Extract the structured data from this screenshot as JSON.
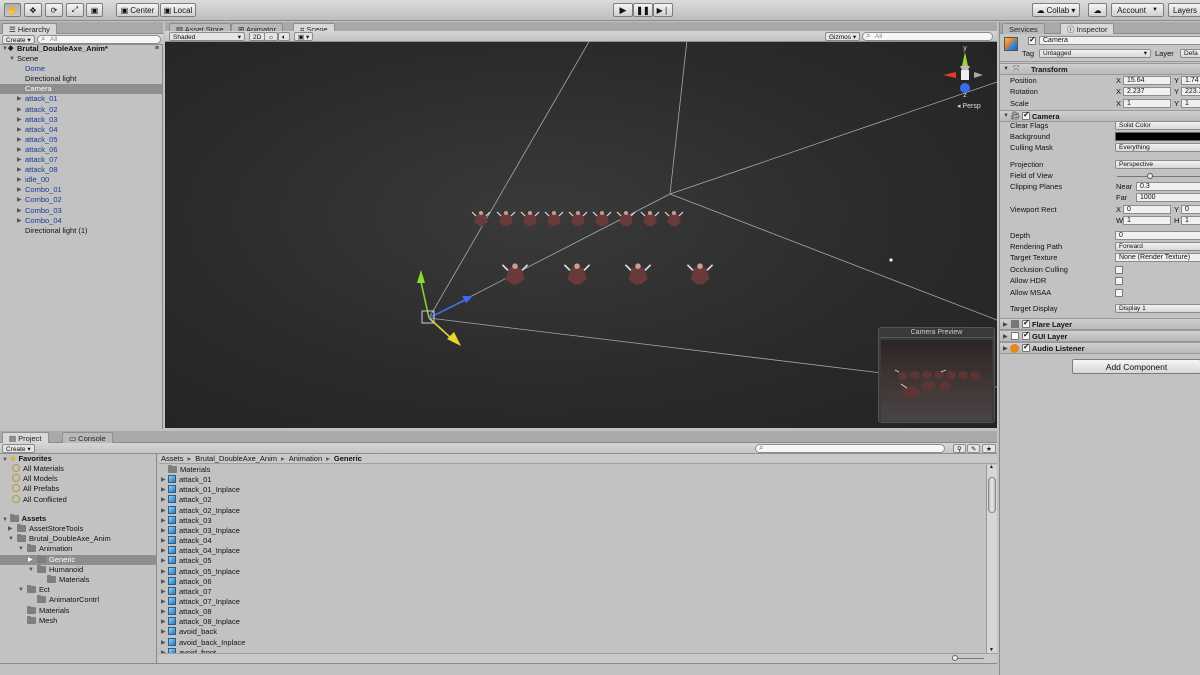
{
  "toolbar": {
    "pivot": "Center",
    "space": "Local",
    "collab": "Collab ▾",
    "account": "Account",
    "layers": "Layers"
  },
  "hierarchy": {
    "tab": "Hierarchy",
    "create": "Create",
    "search_placeholder": "All",
    "scene_name": "Brutal_DoubleAxe_Anim*",
    "items": [
      {
        "label": "Scene",
        "indent": 1,
        "tri": true,
        "open": true,
        "blue": false,
        "sel": false
      },
      {
        "label": "Dome",
        "indent": 2,
        "tri": false,
        "blue": true,
        "sel": false
      },
      {
        "label": "Directional light",
        "indent": 2,
        "tri": false,
        "blue": false,
        "sel": false
      },
      {
        "label": "Camera",
        "indent": 2,
        "tri": false,
        "blue": false,
        "sel": true
      },
      {
        "label": "attack_01",
        "indent": 2,
        "tri": true,
        "blue": true,
        "sel": false
      },
      {
        "label": "attack_02",
        "indent": 2,
        "tri": true,
        "blue": true,
        "sel": false
      },
      {
        "label": "attack_03",
        "indent": 2,
        "tri": true,
        "blue": true,
        "sel": false
      },
      {
        "label": "attack_04",
        "indent": 2,
        "tri": true,
        "blue": true,
        "sel": false
      },
      {
        "label": "attack_05",
        "indent": 2,
        "tri": true,
        "blue": true,
        "sel": false
      },
      {
        "label": "attack_06",
        "indent": 2,
        "tri": true,
        "blue": true,
        "sel": false
      },
      {
        "label": "attack_07",
        "indent": 2,
        "tri": true,
        "blue": true,
        "sel": false
      },
      {
        "label": "attack_08",
        "indent": 2,
        "tri": true,
        "blue": true,
        "sel": false
      },
      {
        "label": "idle_00",
        "indent": 2,
        "tri": true,
        "blue": true,
        "sel": false
      },
      {
        "label": "Combo_01",
        "indent": 2,
        "tri": true,
        "blue": true,
        "sel": false
      },
      {
        "label": "Combo_02",
        "indent": 2,
        "tri": true,
        "blue": true,
        "sel": false
      },
      {
        "label": "Combo_03",
        "indent": 2,
        "tri": true,
        "blue": true,
        "sel": false
      },
      {
        "label": "Combo_04",
        "indent": 2,
        "tri": true,
        "blue": true,
        "sel": false
      },
      {
        "label": "Directional light (1)",
        "indent": 2,
        "tri": false,
        "blue": false,
        "sel": false
      }
    ]
  },
  "scene_tabs": [
    "Asset Store",
    "Animator",
    "Scene"
  ],
  "scene_bar": {
    "shading": "Shaded",
    "mode_2d": "2D",
    "gizmos": "Gizmos",
    "search_placeholder": "All",
    "persp": "Persp",
    "axis_y": "y",
    "axis_z": "z",
    "camera_preview": "Camera Preview"
  },
  "project": {
    "tabs": [
      "Project",
      "Console"
    ],
    "create": "Create",
    "favorites_title": "Favorites",
    "favorites": [
      "All Materials",
      "All Models",
      "All Prefabs",
      "All Conflicted"
    ],
    "assets_title": "Assets",
    "tree": [
      {
        "label": "AssetStoreTools",
        "indent": 1,
        "tri": "closed",
        "sel": false
      },
      {
        "label": "Brutal_DoubleAxe_Anim",
        "indent": 1,
        "tri": "open",
        "sel": false
      },
      {
        "label": "Animation",
        "indent": 2,
        "tri": "open",
        "sel": false
      },
      {
        "label": "Generic",
        "indent": 3,
        "tri": "closed",
        "sel": true
      },
      {
        "label": "Humanoid",
        "indent": 3,
        "tri": "open",
        "sel": false
      },
      {
        "label": "Materials",
        "indent": 4,
        "tri": "none",
        "sel": false
      },
      {
        "label": "Ect",
        "indent": 2,
        "tri": "open",
        "sel": false
      },
      {
        "label": "AnimatorContrl",
        "indent": 3,
        "tri": "none",
        "sel": false
      },
      {
        "label": "Materials",
        "indent": 2,
        "tri": "none",
        "sel": false
      },
      {
        "label": "Mesh",
        "indent": 2,
        "tri": "none",
        "sel": false
      }
    ],
    "breadcrumb": [
      "Assets",
      "Brutal_DoubleAxe_Anim",
      "Animation",
      "Generic"
    ],
    "files": [
      {
        "label": "Materials",
        "type": "folder"
      },
      {
        "label": "attack_01",
        "type": "asset"
      },
      {
        "label": "attack_01_Inplace",
        "type": "asset"
      },
      {
        "label": "attack_02",
        "type": "asset"
      },
      {
        "label": "attack_02_Inplace",
        "type": "asset"
      },
      {
        "label": "attack_03",
        "type": "asset"
      },
      {
        "label": "attack_03_Inplace",
        "type": "asset"
      },
      {
        "label": "attack_04",
        "type": "asset"
      },
      {
        "label": "attack_04_Inplace",
        "type": "asset"
      },
      {
        "label": "attack_05",
        "type": "asset"
      },
      {
        "label": "attack_05_Inplace",
        "type": "asset"
      },
      {
        "label": "attack_06",
        "type": "asset"
      },
      {
        "label": "attack_07",
        "type": "asset"
      },
      {
        "label": "attack_07_Inplace",
        "type": "asset"
      },
      {
        "label": "attack_08",
        "type": "asset"
      },
      {
        "label": "attack_08_Inplace",
        "type": "asset"
      },
      {
        "label": "avoid_back",
        "type": "asset"
      },
      {
        "label": "avoid_back_Inplace",
        "type": "asset"
      },
      {
        "label": "avoid_front",
        "type": "asset"
      }
    ]
  },
  "inspector": {
    "tabs": [
      "Services",
      "Inspector"
    ],
    "object_name": "Camera",
    "tag_label": "Tag",
    "tag_value": "Untagged",
    "layer_label": "Layer",
    "layer_value": "Defa",
    "transform": {
      "title": "Transform",
      "rows": [
        {
          "label": "Position",
          "x": "15.64",
          "y": "1.74"
        },
        {
          "label": "Rotation",
          "x": "2.237",
          "y": "223.3"
        },
        {
          "label": "Scale",
          "x": "1",
          "y": "1"
        }
      ]
    },
    "camera": {
      "title": "Camera",
      "clear_flags": {
        "label": "Clear Flags",
        "value": "Solid Color"
      },
      "background": {
        "label": "Background",
        "color": "#000000"
      },
      "culling_mask": {
        "label": "Culling Mask",
        "value": "Everything"
      },
      "projection": {
        "label": "Projection",
        "value": "Perspective"
      },
      "fov": {
        "label": "Field of View"
      },
      "clipping": {
        "label": "Clipping Planes",
        "near_label": "Near",
        "near": "0.3",
        "far_label": "Far",
        "far": "1000"
      },
      "viewport": {
        "label": "Viewport Rect",
        "x": "0",
        "y": "0",
        "w": "1",
        "h": "1"
      },
      "depth": {
        "label": "Depth",
        "value": "0"
      },
      "rendering_path": {
        "label": "Rendering Path",
        "value": "Forward"
      },
      "target_texture": {
        "label": "Target Texture",
        "value": "None (Render Texture)"
      },
      "occlusion": {
        "label": "Occlusion Culling"
      },
      "hdr": {
        "label": "Allow HDR"
      },
      "msaa": {
        "label": "Allow MSAA"
      },
      "target_display": {
        "label": "Target Display",
        "value": "Display 1"
      }
    },
    "components": [
      "Flare Layer",
      "GUI Layer",
      "Audio Listener"
    ],
    "add_component": "Add Component"
  }
}
